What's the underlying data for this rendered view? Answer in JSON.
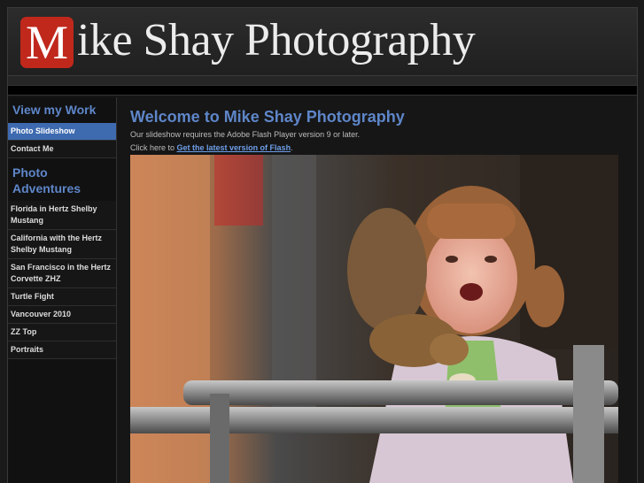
{
  "header": {
    "logo_letter": "M",
    "title": "ike Shay Photography",
    "accent": "#c0281c"
  },
  "sidebar": {
    "heading_work": "View my Work",
    "work_items": [
      {
        "label": "Photo Slideshow",
        "active": true
      },
      {
        "label": "Contact Me",
        "active": false
      }
    ],
    "heading_adventures": "Photo Adventures",
    "adventure_items": [
      {
        "label": "Florida in Hertz Shelby Mustang"
      },
      {
        "label": "California with the Hertz Shelby Mustang"
      },
      {
        "label": "San Francisco in the Hertz Corvette ZHZ"
      },
      {
        "label": "Turtle Fight"
      },
      {
        "label": "Vancouver 2010"
      },
      {
        "label": "ZZ Top"
      },
      {
        "label": "Portraits"
      }
    ]
  },
  "main": {
    "title": "Welcome to Mike Shay Photography",
    "flash_notice": "Our slideshow requires the Adobe Flash Player version 9 or later.",
    "click_prefix": "Click here to ",
    "flash_link": "Get the latest version of Flash",
    "click_suffix": "."
  },
  "colors": {
    "heading_blue": "#5e86c9",
    "active_nav": "#3e6ab0",
    "link": "#6e9ee8"
  }
}
